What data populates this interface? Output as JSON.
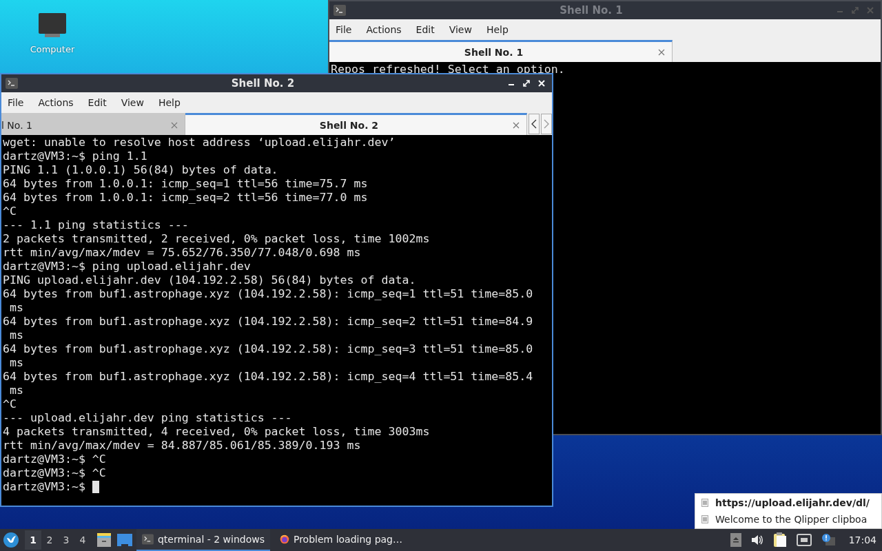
{
  "desktop": {
    "icons": [
      {
        "label": "Computer"
      }
    ]
  },
  "windows": [
    {
      "title": "Shell No. 1",
      "active": false,
      "menu": [
        "File",
        "Actions",
        "Edit",
        "View",
        "Help"
      ],
      "tabs": [
        {
          "label": "Shell No. 1",
          "selected": true
        }
      ],
      "scroll_arrows": false,
      "lines": [
        "Repos refreshed! Select an option."
      ],
      "cursor": false
    },
    {
      "title": "Shell No. 2",
      "active": true,
      "menu": [
        "File",
        "Actions",
        "Edit",
        "View",
        "Help"
      ],
      "tabs": [
        {
          "label": "l No. 1",
          "selected": false
        },
        {
          "label": "Shell No. 2",
          "selected": true
        }
      ],
      "scroll_arrows": true,
      "lines": [
        "wget: unable to resolve host address ‘upload.elijahr.dev’",
        "dartz@VM3:~$ ping 1.1",
        "PING 1.1 (1.0.0.1) 56(84) bytes of data.",
        "64 bytes from 1.0.0.1: icmp_seq=1 ttl=56 time=75.7 ms",
        "64 bytes from 1.0.0.1: icmp_seq=2 ttl=56 time=77.0 ms",
        "^C",
        "--- 1.1 ping statistics ---",
        "2 packets transmitted, 2 received, 0% packet loss, time 1002ms",
        "rtt min/avg/max/mdev = 75.652/76.350/77.048/0.698 ms",
        "dartz@VM3:~$ ping upload.elijahr.dev",
        "PING upload.elijahr.dev (104.192.2.58) 56(84) bytes of data.",
        "64 bytes from buf1.astrophage.xyz (104.192.2.58): icmp_seq=1 ttl=51 time=85.0",
        " ms",
        "64 bytes from buf1.astrophage.xyz (104.192.2.58): icmp_seq=2 ttl=51 time=84.9",
        " ms",
        "64 bytes from buf1.astrophage.xyz (104.192.2.58): icmp_seq=3 ttl=51 time=85.0",
        " ms",
        "64 bytes from buf1.astrophage.xyz (104.192.2.58): icmp_seq=4 ttl=51 time=85.4",
        " ms",
        "^C",
        "--- upload.elijahr.dev ping statistics ---",
        "4 packets transmitted, 4 received, 0% packet loss, time 3003ms",
        "rtt min/avg/max/mdev = 84.887/85.061/85.389/0.193 ms",
        "dartz@VM3:~$ ^C",
        "dartz@VM3:~$ ^C",
        "dartz@VM3:~$ "
      ],
      "cursor": true
    }
  ],
  "clipboard_popup": {
    "items": [
      {
        "text": "https://upload.elijahr.dev/dl/",
        "current": true
      },
      {
        "text": "Welcome to the Qlipper clipboa",
        "current": false
      }
    ]
  },
  "taskbar": {
    "workspaces": [
      {
        "label": "1",
        "selected": true
      },
      {
        "label": "2",
        "selected": false
      },
      {
        "label": "3",
        "selected": false
      },
      {
        "label": "4",
        "selected": false
      }
    ],
    "tasks": [
      {
        "kind": "terminal",
        "label": "qterminal - 2 windows",
        "selected": true
      },
      {
        "kind": "browser",
        "label": "Problem loading pag…",
        "selected": false
      }
    ],
    "clock": "17:04"
  }
}
